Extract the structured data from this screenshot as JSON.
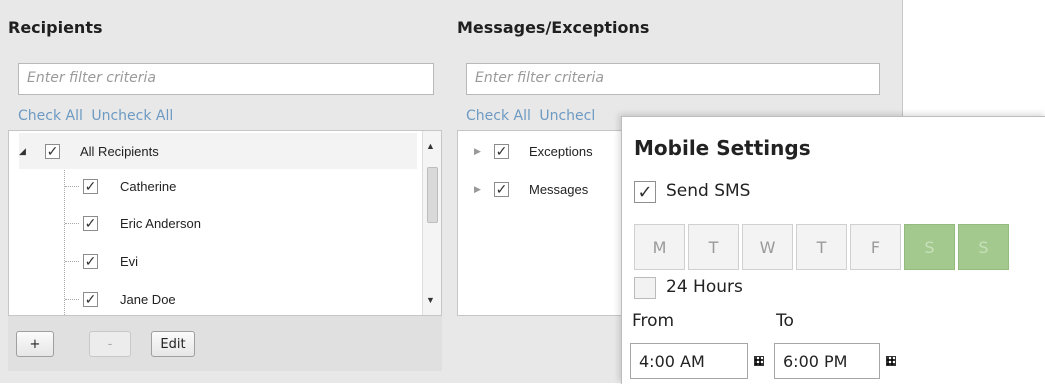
{
  "recipients": {
    "title": "Recipients",
    "filter_placeholder": "Enter filter criteria",
    "check_all": "Check All",
    "uncheck_all": "Uncheck All",
    "tree": {
      "root": "All Recipients",
      "items": [
        "Catherine",
        "Eric Anderson",
        "Evi",
        "Jane Doe"
      ]
    },
    "buttons": {
      "add": "+",
      "remove": "-",
      "edit": "Edit"
    }
  },
  "messages": {
    "title": "Messages/Exceptions",
    "filter_placeholder": "Enter filter criteria",
    "check_all": "Check All",
    "uncheck_all": "Unchecl",
    "items": [
      "Exceptions",
      "Messages"
    ]
  },
  "mobile_settings": {
    "title": "Mobile Settings",
    "send_sms_label": "Send SMS",
    "send_sms_checked": true,
    "days": [
      {
        "label": "M",
        "active": false
      },
      {
        "label": "T",
        "active": false
      },
      {
        "label": "W",
        "active": false
      },
      {
        "label": "T",
        "active": false
      },
      {
        "label": "F",
        "active": false
      },
      {
        "label": "S",
        "active": true
      },
      {
        "label": "S",
        "active": true
      }
    ],
    "hours_label": "24 Hours",
    "hours_checked": false,
    "from_label": "From",
    "to_label": "To",
    "from_value": "4:00 AM",
    "to_value": "6:00 PM"
  },
  "icons": {
    "check": "✓",
    "expand": "◢",
    "collapsed": "▶",
    "up": "▲",
    "down": "▼"
  },
  "colors": {
    "link": "#6d9ac2",
    "active_day": "#a4c98f",
    "panel_bg": "#e8e8e8"
  }
}
